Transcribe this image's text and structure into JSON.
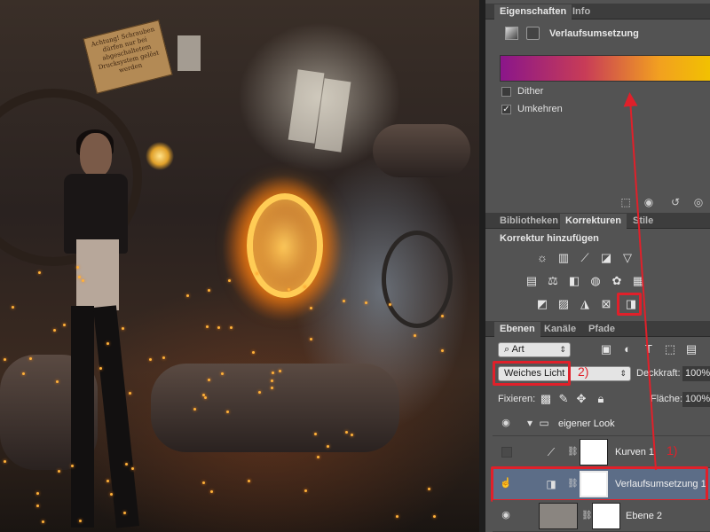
{
  "canvas": {
    "description_icon": "photo-canvas",
    "sign_text": "Achtung! Schrauben dürfen nur bei abgeschaltetem Drucksystem gelöst werden"
  },
  "properties_panel": {
    "tabs": [
      "Eigenschaften",
      "Info"
    ],
    "title": "Verlaufsumsetzung",
    "gradient_colors": [
      "#8a168a",
      "#c83c57",
      "#f2a020",
      "#f2c200"
    ],
    "dither": {
      "label": "Dither",
      "checked": false
    },
    "reverse": {
      "label": "Umkehren",
      "checked": true
    }
  },
  "corrections_panel": {
    "tabs": [
      "Bibliotheken",
      "Korrekturen",
      "Stile"
    ],
    "title": "Korrektur hinzufügen"
  },
  "layers_panel": {
    "tabs": [
      "Ebenen",
      "Kanäle",
      "Pfade"
    ],
    "filter_kind": "Art",
    "blend_mode": "Weiches Licht",
    "opacity_label": "Deckkraft:",
    "opacity_value": "100%",
    "lock_label": "Fixieren:",
    "fill_label": "Fläche:",
    "fill_value": "100%",
    "layers": [
      {
        "name": "eigener Look",
        "type": "group",
        "visible": true
      },
      {
        "name": "Kurven 1",
        "type": "adjustment",
        "visible": false
      },
      {
        "name": "Verlaufsumsetzung 1",
        "type": "adjustment",
        "visible": true,
        "selected": true
      },
      {
        "name": "Ebene 2",
        "type": "pixel",
        "visible": true
      }
    ]
  },
  "annotations": {
    "marker_1": "1)",
    "marker_2": "2)",
    "highlight_color": "#e0202a"
  }
}
